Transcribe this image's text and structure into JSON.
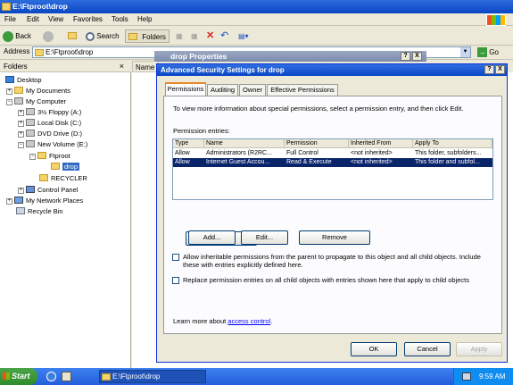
{
  "explorer": {
    "title": "E:\\Ftproot\\drop",
    "menu": [
      "File",
      "Edit",
      "View",
      "Favorites",
      "Tools",
      "Help"
    ],
    "toolbar": {
      "back": "Back",
      "search": "Search",
      "folders": "Folders"
    },
    "address_label": "Address",
    "address_value": "E:\\Ftproot\\drop",
    "go_label": "Go",
    "folders_pane_title": "Folders",
    "folders_close": "×",
    "name_column": "Name",
    "tree": [
      {
        "label": "Desktop"
      },
      {
        "label": "My Documents"
      },
      {
        "label": "My Computer"
      },
      {
        "label": "3½ Floppy (A:)"
      },
      {
        "label": "Local Disk (C:)"
      },
      {
        "label": "DVD Drive (D:)"
      },
      {
        "label": "New Volume (E:)"
      },
      {
        "label": "Ftproot"
      },
      {
        "label": "drop"
      },
      {
        "label": "RECYCLER"
      },
      {
        "label": "Control Panel"
      },
      {
        "label": "My Network Places"
      },
      {
        "label": "Recycle Bin"
      }
    ]
  },
  "properties": {
    "title": "drop Properties",
    "help": "?",
    "close": "X"
  },
  "dialog": {
    "title": "Advanced Security Settings for drop",
    "help": "?",
    "close": "X",
    "tabs": [
      "Permissions",
      "Auditing",
      "Owner",
      "Effective Permissions"
    ],
    "info_text": "To view more information about special permissions, select a permission entry, and then click Edit.",
    "entries_label": "Permission entries:",
    "columns": [
      "Type",
      "Name",
      "Permission",
      "Inherited From",
      "Apply To"
    ],
    "rows": [
      [
        "Allow",
        "Administrators (R2RC...",
        "Full Control",
        "<not inherited>",
        "This folder, subfolders..."
      ],
      [
        "Allow",
        "Internet Guest Accou...",
        "Read & Execute",
        "<not inherited>",
        "This folder and subfol..."
      ]
    ],
    "buttons": {
      "add": "Add...",
      "edit": "Edit...",
      "remove": "Remove"
    },
    "inherit_text_1": "Allow inheritable permissions from the parent to propagate to this object and all child objects. Include",
    "inherit_text_2": "these with entries explicitly defined here.",
    "replace_text": "Replace permission entries on all child objects with entries shown here that apply to child objects",
    "learn_prefix": "Learn more about ",
    "learn_link": "access control",
    "learn_suffix": ".",
    "ok": "OK",
    "cancel": "Cancel",
    "apply": "Apply"
  },
  "taskbar": {
    "start": "Start",
    "task_item": "E:\\Ftproot\\drop",
    "time": "9:59 AM"
  }
}
